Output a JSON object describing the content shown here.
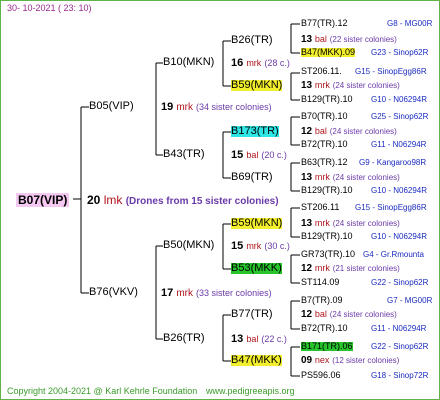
{
  "header": {
    "date": "30- 10-2021 ( 23: 10)"
  },
  "footer": {
    "copyright": "Copyright 2004-2021 @ Karl Kehrle Foundation",
    "site": "www.pedigreeapis.org"
  },
  "root": {
    "name": "B07(VIP)",
    "gen_num": "20",
    "mark": "lmk",
    "note": "(Drones from 15 sister colonies)"
  },
  "level1": [
    {
      "name": "B05(VIP)",
      "gen_num": "19",
      "mark": "mrk",
      "note": "(34 sister colonies)"
    },
    {
      "name": "B76(VKV)",
      "gen_num": "17",
      "mark": "mrk",
      "note": "(33 sister colonies)"
    }
  ],
  "level2": [
    {
      "name": "B10(MKN)",
      "gen_num": "16",
      "mark": "mrk",
      "note": "(28 c.)"
    },
    {
      "name": "B43(TR)",
      "gen_num": "15",
      "mark": "bal",
      "note": "(20 c.)"
    },
    {
      "name": "B50(MKN)",
      "gen_num": "15",
      "mark": "mrk",
      "note": "(30 c.)"
    },
    {
      "name": "B26(TR)",
      "gen_num": "13",
      "mark": "bal",
      "note": "(22 c.)"
    }
  ],
  "level3": [
    {
      "name": "B26(TR)",
      "gen_num": "13",
      "mark": "bal",
      "note": "(22 sister colonies)"
    },
    {
      "name": "B59(MKN)",
      "gen_num": "13",
      "mark": "mrk",
      "note": "(24 sister colonies)"
    },
    {
      "name": "B173(TR)",
      "gen_num": "12",
      "mark": "bal",
      "note": "(24 sister colonies)"
    },
    {
      "name": "B69(TR)",
      "gen_num": "13",
      "mark": "mrk",
      "note": "(24 sister colonies)"
    },
    {
      "name": "B59(MKN)",
      "gen_num": "13",
      "mark": "mrk",
      "note": "(24 sister colonies)"
    },
    {
      "name": "B53(MKK)",
      "gen_num": "12",
      "mark": "mrk",
      "note": "(21 sister colonies)"
    },
    {
      "name": "B77(TR)",
      "gen_num": "12",
      "mark": "bal",
      "note": "(24 sister colonies)"
    },
    {
      "name": "B47(MKK)",
      "gen_num": "09",
      "mark": "nex",
      "note": "(12 sister colonies)"
    }
  ],
  "leaves": [
    {
      "name": "B77(TR).12",
      "info": "G8 - MG00R"
    },
    {
      "name": "B47(MKK).09",
      "info": "G23 - Sinop62R"
    },
    {
      "name": "ST206.11.",
      "info": "G15 - SinopEgg86R"
    },
    {
      "name": "B129(TR).10",
      "info": "G10 - N06294R"
    },
    {
      "name": "B70(TR).10",
      "info": "G25 - Sinop62R"
    },
    {
      "name": "B72(TR).10",
      "info": "G11 - N06294R"
    },
    {
      "name": "B63(TR).12",
      "info": "G9 - Kangaroo98R"
    },
    {
      "name": "B129(TR).10",
      "info": "G10 - N06294R"
    },
    {
      "name": "ST206.11",
      "info": "G15 - SinopEgg86R"
    },
    {
      "name": "B129(TR).10",
      "info": "G10 - N06294R"
    },
    {
      "name": "GR73(TR).10",
      "info": "G4 - Gr.Rmounta"
    },
    {
      "name": "ST114.09",
      "info": "G22 - Sinop62R"
    },
    {
      "name": "B7(TR).09",
      "info": "G7 - MG00R"
    },
    {
      "name": "B72(TR).10",
      "info": "G11 - N06294R"
    },
    {
      "name": "B171(TR).06",
      "info": "G22 - Sinop62R"
    },
    {
      "name": "PS596.06",
      "info": "G18 - Sinop72R"
    }
  ]
}
